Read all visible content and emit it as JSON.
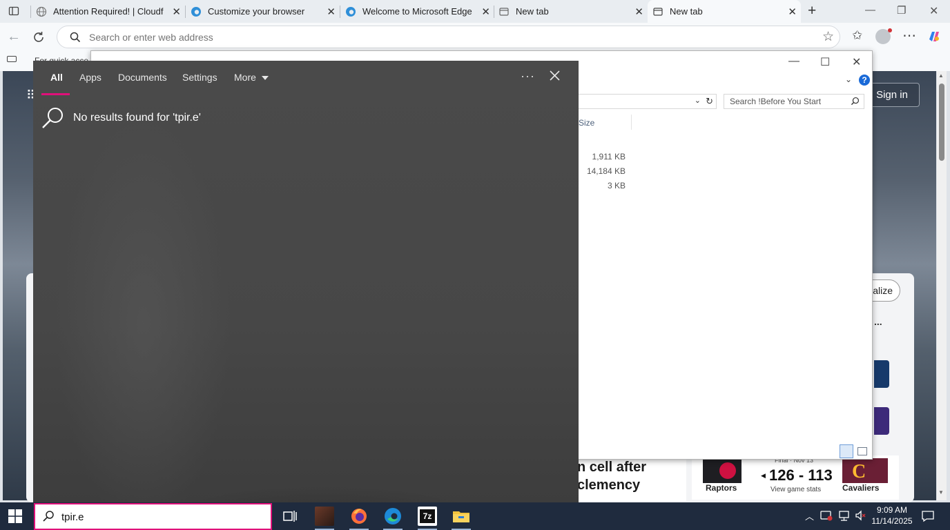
{
  "browser": {
    "tabs": [
      {
        "label": "Attention Required! | Cloudflare",
        "active": false
      },
      {
        "label": "Customize your browser",
        "active": false
      },
      {
        "label": "Welcome to Microsoft Edge",
        "active": false
      },
      {
        "label": "New tab",
        "active": false
      },
      {
        "label": "New tab",
        "active": true
      }
    ],
    "new_tab_symbol": "+",
    "address_placeholder": "Search or enter web address",
    "favorites_text": "For quick acce"
  },
  "page": {
    "signin_label": "Sign in",
    "personalize_label": "alize",
    "menu_dots": "...",
    "headline": "n cell after clemency",
    "score": {
      "final_label": "Final · Nov 13",
      "result": "126 - 113",
      "stats_label": "View game stats",
      "home_team": "Raptors",
      "away_team": "Cavaliers"
    }
  },
  "explorer": {
    "search_placeholder": "Search !Before You Start",
    "size_header": "Size",
    "sizes": [
      "1,911 KB",
      "14,184 KB",
      "3 KB"
    ]
  },
  "search_panel": {
    "tabs": [
      "All",
      "Apps",
      "Documents",
      "Settings",
      "More"
    ],
    "active_tab": "All",
    "ellipsis": "···",
    "no_results": "No results found for 'tpir.e'"
  },
  "taskbar": {
    "search_value": "tpir.e",
    "time": "9:09 AM",
    "date": "11/14/2025"
  },
  "colors": {
    "accent": "#e0107a",
    "taskbar": "#1f2b3e",
    "panel": "#474747",
    "edge_blue": "#1a6ad8"
  }
}
